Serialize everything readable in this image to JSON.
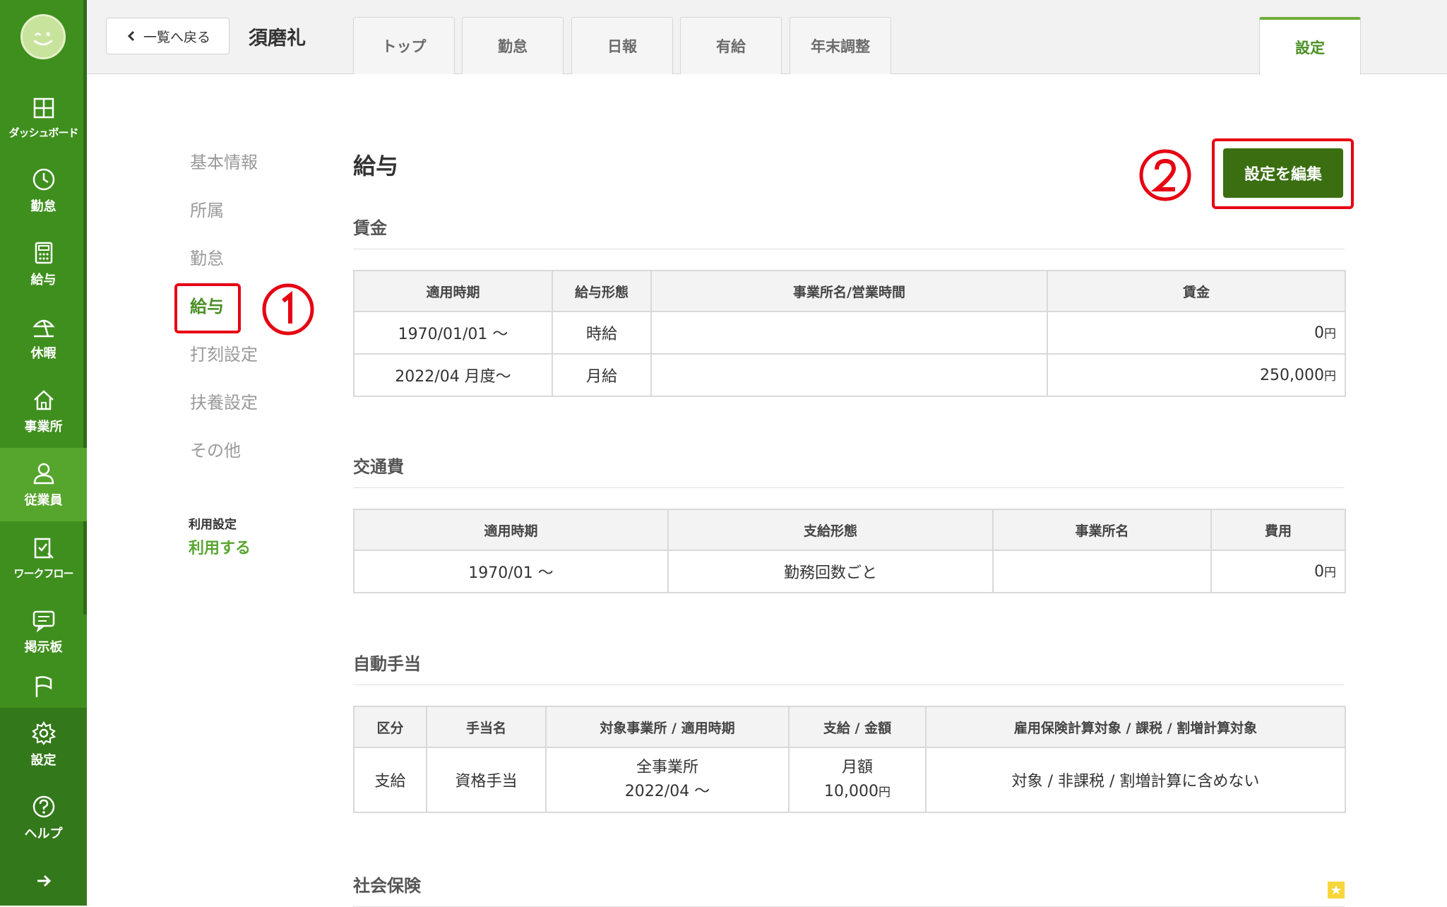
{
  "sidebar": {
    "items": [
      {
        "label": "ダッシュボード",
        "icon": "dashboard-icon"
      },
      {
        "label": "勤怠",
        "icon": "clock-icon"
      },
      {
        "label": "給与",
        "icon": "calculator-icon"
      },
      {
        "label": "休暇",
        "icon": "beach-umbrella-icon"
      },
      {
        "label": "事業所",
        "icon": "home-icon"
      },
      {
        "label": "従業員",
        "icon": "person-icon"
      },
      {
        "label": "ワークフロー",
        "icon": "checklist-icon"
      },
      {
        "label": "掲示板",
        "icon": "chat-icon"
      },
      {
        "label": "",
        "icon": "flag-icon"
      }
    ],
    "bottom_items": [
      {
        "label": "設定",
        "icon": "gear-icon"
      },
      {
        "label": "ヘルプ",
        "icon": "help-icon"
      }
    ]
  },
  "header": {
    "back_label": "一覧へ戻る",
    "employee_name": "須磨礼",
    "tabs": [
      "トップ",
      "勤怠",
      "日報",
      "有給",
      "年末調整"
    ],
    "active_tab": "設定"
  },
  "submenu": {
    "items": [
      "基本情報",
      "所属",
      "勤怠",
      "給与",
      "打刻設定",
      "扶養設定",
      "その他"
    ],
    "usage_label": "利用設定",
    "usage_value": "利用する"
  },
  "annotations": {
    "marker1": "①",
    "marker2": "②"
  },
  "page": {
    "title": "給与",
    "edit_button": "設定を編集"
  },
  "wage": {
    "title": "賃金",
    "headers": [
      "適用時期",
      "給与形態",
      "事業所名/営業時間",
      "賃金"
    ],
    "rows": [
      {
        "period": "1970/01/01 〜",
        "type": "時給",
        "office": "",
        "amount": "0",
        "unit": "円"
      },
      {
        "period": "2022/04 月度〜",
        "type": "月給",
        "office": "",
        "amount": "250,000",
        "unit": "円"
      }
    ]
  },
  "transport": {
    "title": "交通費",
    "headers": [
      "適用時期",
      "支給形態",
      "事業所名",
      "費用"
    ],
    "rows": [
      {
        "period": "1970/01 〜",
        "type": "勤務回数ごと",
        "office": "",
        "amount": "0",
        "unit": "円"
      }
    ]
  },
  "allowance": {
    "title": "自動手当",
    "headers": [
      "区分",
      "手当名",
      "対象事業所 / 適用時期",
      "支給 / 金額",
      "雇用保険計算対象 / 課税 / 割増計算対象"
    ],
    "rows": [
      {
        "category": "支給",
        "name": "資格手当",
        "office": "全事業所",
        "period": "2022/04 〜",
        "pay_type": "月額",
        "amount": "10,000",
        "unit": "円",
        "flags": "対象 / 非課税 / 割増計算に含めない"
      }
    ]
  },
  "social_insurance": {
    "title": "社会保険"
  },
  "colors": {
    "sidebar": "#3f8f1e",
    "accent": "#4a8f24",
    "edit_button": "#3a6e10",
    "annotation_red": "#e60012"
  }
}
